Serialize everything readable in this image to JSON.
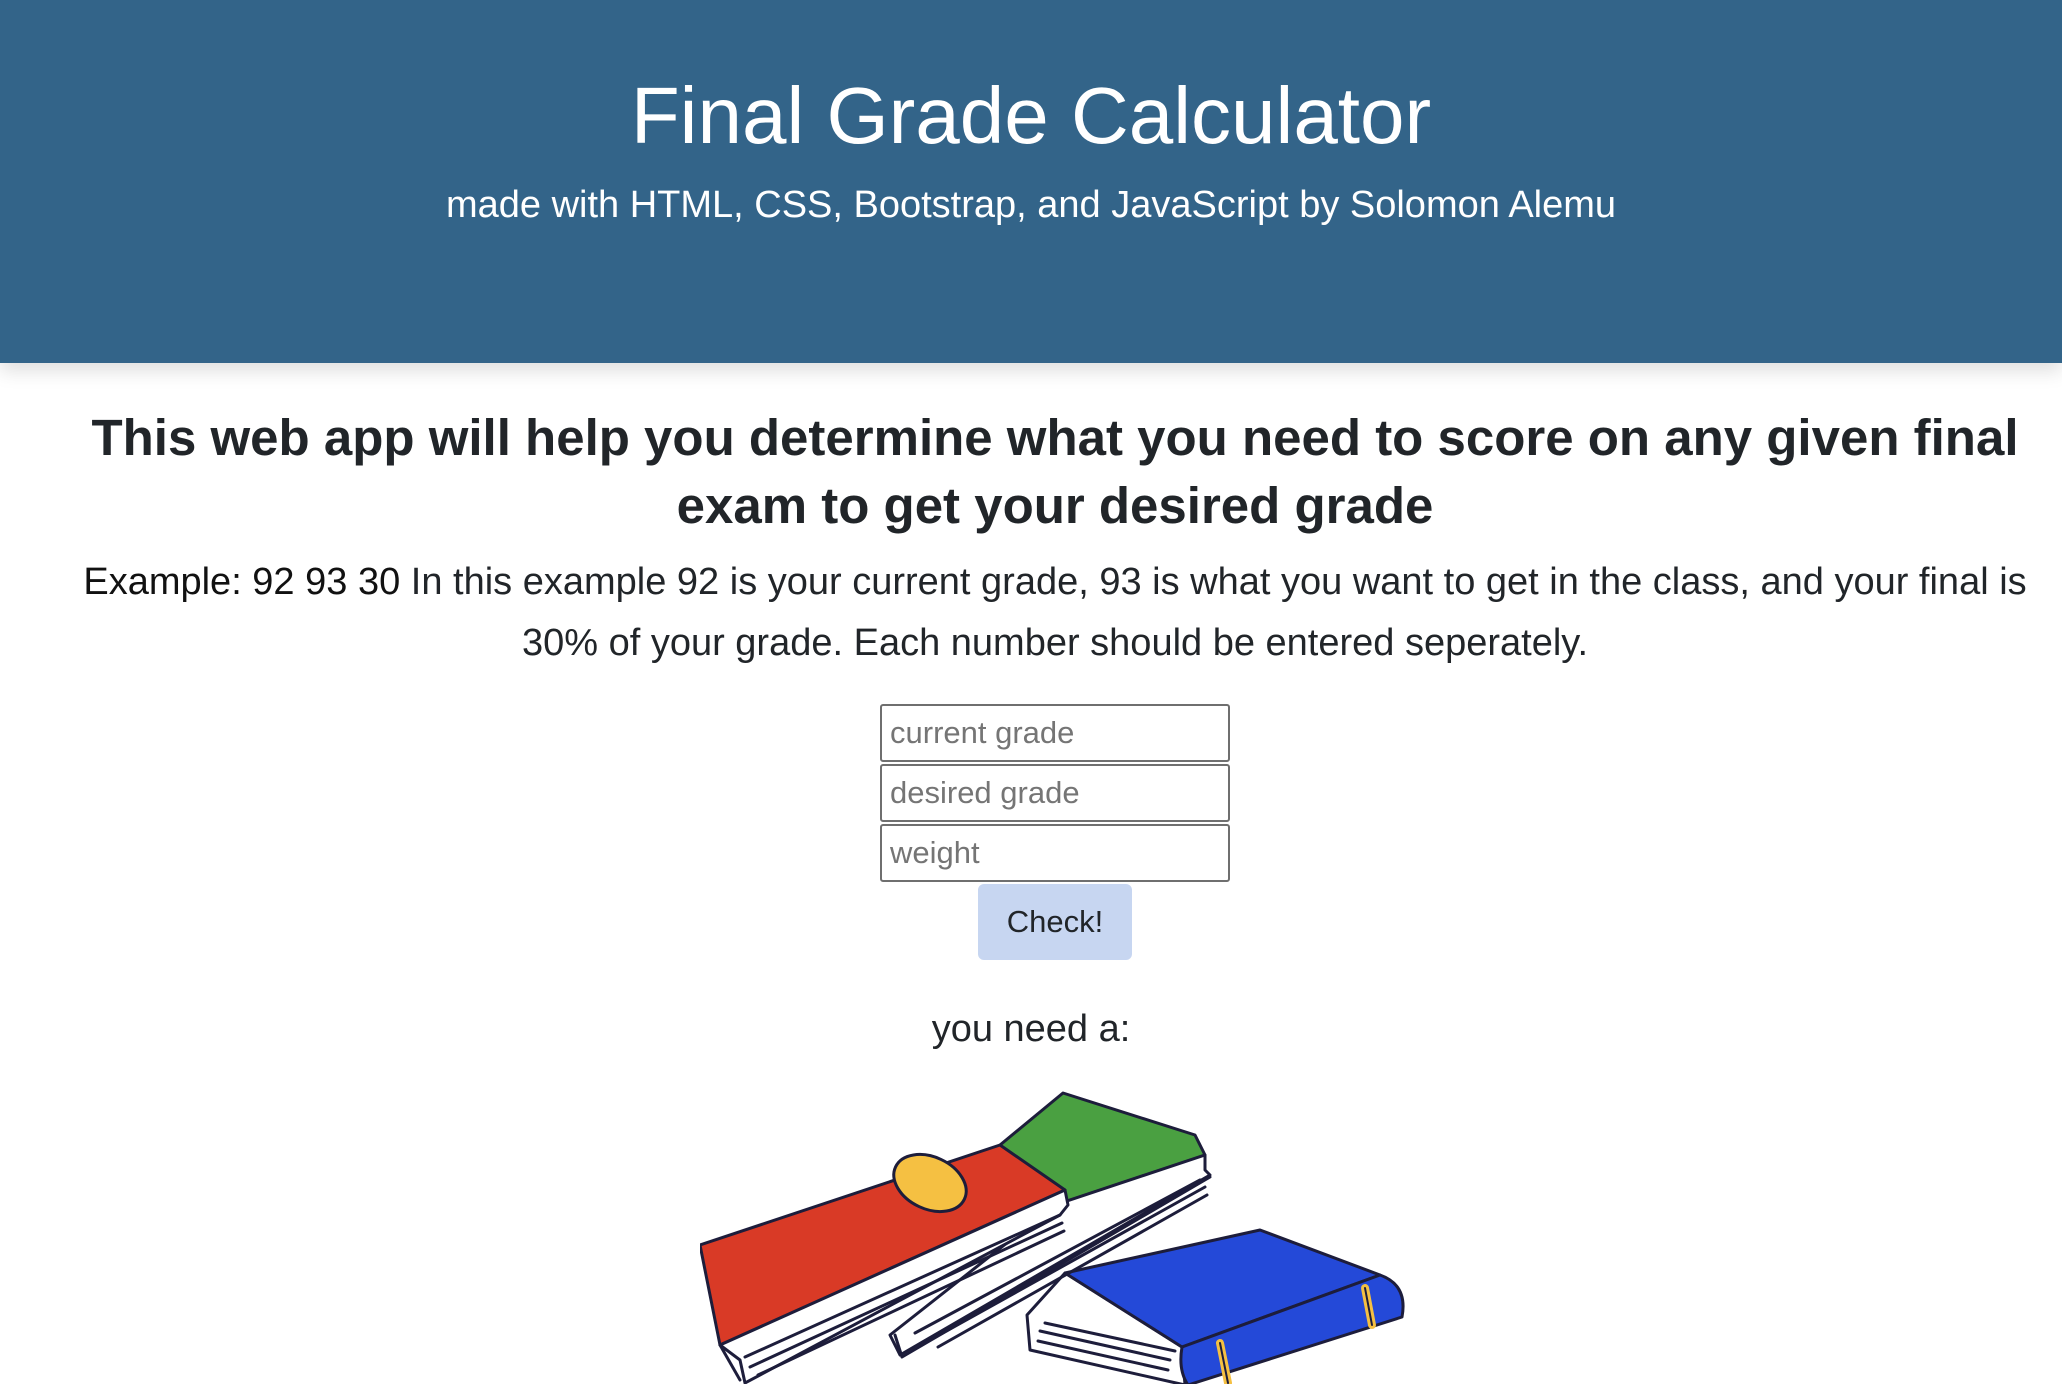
{
  "header": {
    "title": "Final Grade Calculator",
    "subtitle": "made with HTML, CSS, Bootstrap, and JavaScript by Solomon Alemu"
  },
  "main": {
    "heading": "This web app will help you determine what you need to score on any given final exam to get your desired grade",
    "example_label": "Example: 92 93 30",
    "example_text": " In this example 92 is your current grade, 93 is what you want to get in the class, and your final is 30% of your grade. Each number should be entered seperately."
  },
  "form": {
    "current_placeholder": "current grade",
    "desired_placeholder": "desired grade",
    "weight_placeholder": "weight",
    "check_label": "Check!"
  },
  "result": {
    "label": "you need a:"
  },
  "illustration": {
    "icon": "books-icon"
  },
  "colors": {
    "header_bg": "#336489",
    "button_bg": "#c7d6f1",
    "book_red": "#d93a26",
    "book_green": "#4aa041",
    "book_blue": "#2449d8",
    "book_yellow": "#f5c042"
  }
}
